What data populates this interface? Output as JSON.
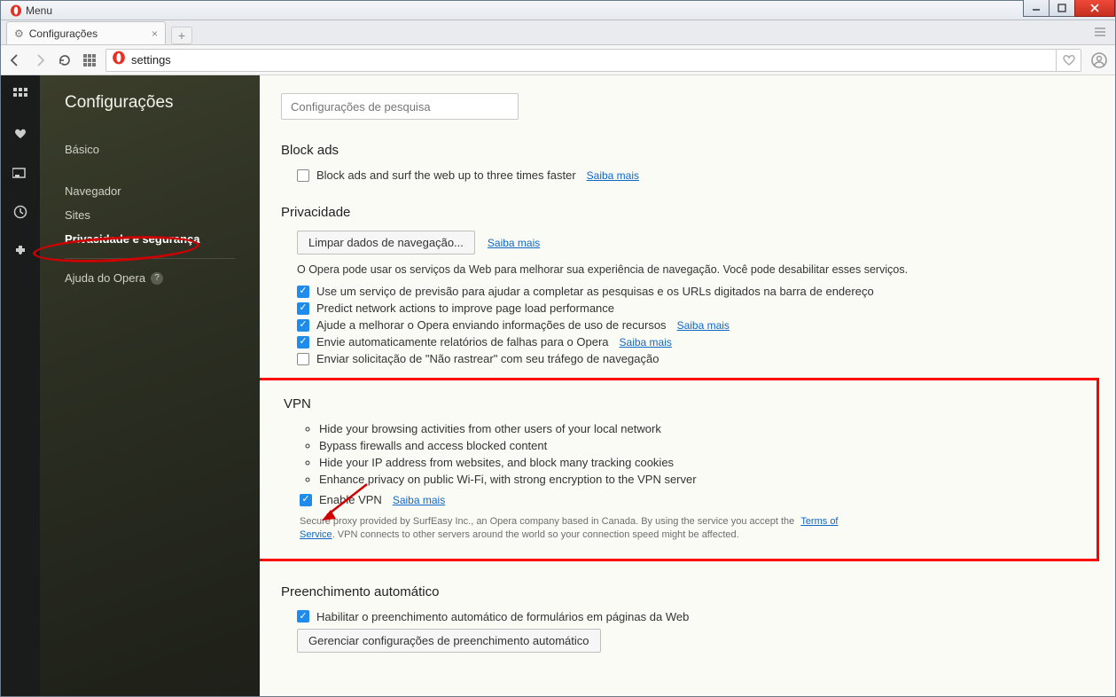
{
  "window": {
    "menu_label": "Menu"
  },
  "tab": {
    "title": "Configurações"
  },
  "address": {
    "value": "settings"
  },
  "sidebar": {
    "title": "Configurações",
    "basic": "Básico",
    "browser": "Navegador",
    "sites": "Sites",
    "privacy": "Privacidade e segurança",
    "help": "Ajuda do Opera"
  },
  "search": {
    "placeholder": "Configurações de pesquisa"
  },
  "sections": {
    "block_ads": {
      "heading": "Block ads",
      "checkbox": "Block ads and surf the web up to three times faster",
      "learn": "Saiba mais"
    },
    "privacy": {
      "heading": "Privacidade",
      "clear_btn": "Limpar dados de navegação...",
      "clear_learn": "Saiba mais",
      "desc": "O Opera pode usar os serviços da Web para melhorar sua experiência de navegação. Você pode desabilitar esses serviços.",
      "c1": "Use um serviço de previsão para ajudar a completar as pesquisas e os URLs digitados na barra de endereço",
      "c2": "Predict network actions to improve page load performance",
      "c3": "Ajude a melhorar o Opera enviando informações de uso de recursos",
      "c3_learn": "Saiba mais",
      "c4": "Envie automaticamente relatórios de falhas para o Opera",
      "c4_learn": "Saiba mais",
      "c5": "Enviar solicitação de \"Não rastrear\" com seu tráfego de navegação"
    },
    "vpn": {
      "heading": "VPN",
      "b1": "Hide your browsing activities from other users of your local network",
      "b2": "Bypass firewalls and access blocked content",
      "b3": "Hide your IP address from websites, and block many tracking cookies",
      "b4": "Enhance privacy on public Wi-Fi, with strong encryption to the VPN server",
      "enable": "Enable VPN",
      "enable_learn": "Saiba mais",
      "fine1": "Secure proxy provided by SurfEasy Inc., an Opera company based in Canada. By using the service you accept the ",
      "tos": "Terms of Service",
      "fine2": ". VPN connects to other servers around the world so your connection speed might be affected."
    },
    "autofill": {
      "heading": "Preenchimento automático",
      "c1": "Habilitar o preenchimento automático de formulários em páginas da Web",
      "manage_btn": "Gerenciar configurações de preenchimento automático"
    }
  }
}
